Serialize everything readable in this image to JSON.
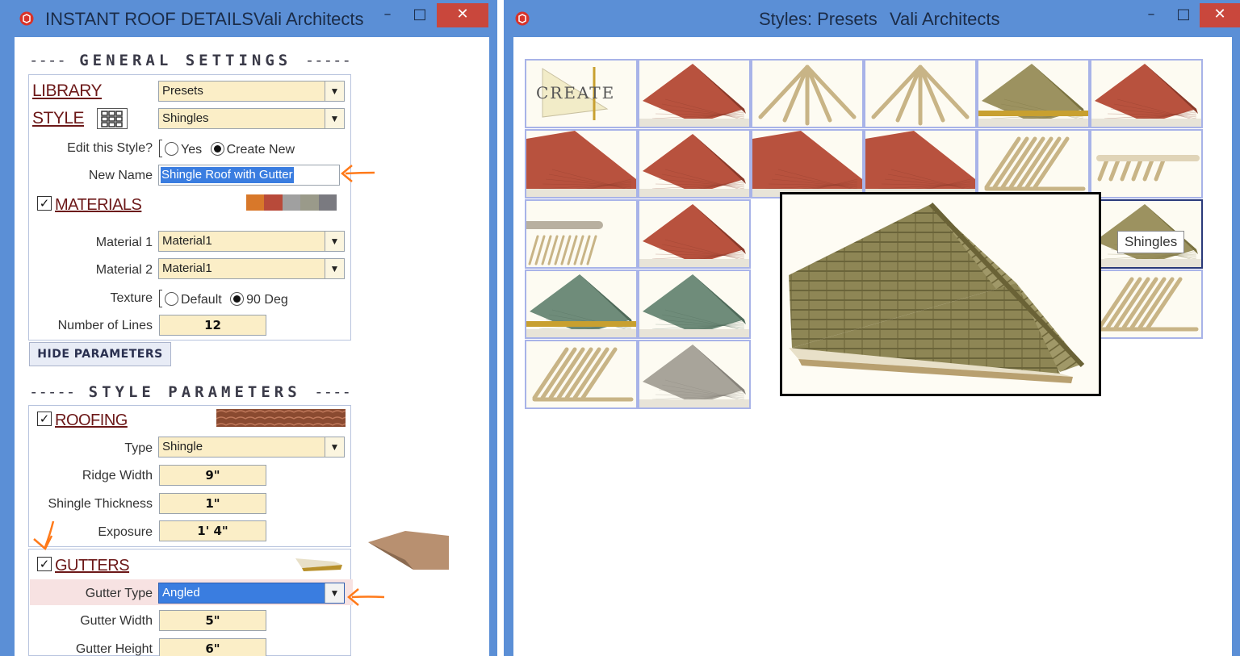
{
  "left_window": {
    "title": "INSTANT ROOF DETAILS",
    "subtitle": "Vali Architects",
    "min_label": "–",
    "max_label": "□",
    "close_label": "✕"
  },
  "right_window": {
    "title": "Styles: Presets",
    "subtitle": "Vali Architects",
    "min_label": "–",
    "max_label": "□",
    "close_label": "✕"
  },
  "general": {
    "heading_dash_left": "----",
    "heading": "GENERAL SETTINGS",
    "heading_dash_right": "-----",
    "library_label": "LIBRARY",
    "library_value": "Presets",
    "style_label": "STYLE",
    "style_value": "Shingles",
    "edit_style_label": "Edit this Style?",
    "edit_yes": "Yes",
    "edit_create_new": "Create New",
    "new_name_label": "New Name",
    "new_name_value": "Shingle Roof with Gutter",
    "materials_label": "MATERIALS",
    "materials_checked": "✓",
    "material1_label": "Material 1",
    "material1_value": "Material1",
    "material2_label": "Material 2",
    "material2_value": "Material1",
    "texture_label": "Texture",
    "texture_default": "Default",
    "texture_90": "90 Deg",
    "lines_label": "Number of Lines",
    "lines_value": "12",
    "hide_button": "HIDE PARAMETERS",
    "swatch_colors": [
      "#d8782a",
      "#b84a3a",
      "#a0a0a0",
      "#9a9a8a",
      "#7a7a80"
    ]
  },
  "style_params": {
    "heading_dash_left": "-----",
    "heading": "STYLE PARAMETERS",
    "heading_dash_right": "----",
    "roofing_label": "ROOFING",
    "roofing_checked": "✓",
    "type_label": "Type",
    "type_value": "Shingle",
    "ridge_label": "Ridge Width",
    "ridge_value": "9\"",
    "thickness_label": "Shingle Thickness",
    "thickness_value": "1\"",
    "exposure_label": "Exposure",
    "exposure_value": "1' 4\"",
    "gutters_label": "GUTTERS",
    "gutters_checked": "✓",
    "gutter_type_label": "Gutter Type",
    "gutter_type_value": "Angled",
    "gutter_width_label": "Gutter Width",
    "gutter_width_value": "5\"",
    "gutter_height_label": "Gutter Height",
    "gutter_height_value": "6\""
  },
  "gallery": {
    "create_tile_label": "CREATE",
    "tooltip": "Shingles",
    "tile_types": [
      [
        "create",
        "red-hip",
        "rafters",
        "rafters",
        "shingle-edge",
        "red-hip"
      ],
      [
        "red-tile",
        "red-hip",
        "red-tile",
        "red-tile",
        "trusses",
        "rafter-end"
      ],
      [
        "rafter-detail",
        "red-hip",
        "",
        "",
        "",
        "shingle-hip"
      ],
      [
        "green-edge",
        "green-hip",
        "",
        "",
        "",
        "trusses"
      ],
      [
        "trusses",
        "grey-hip",
        "",
        "",
        "",
        ""
      ]
    ]
  },
  "colors": {
    "titlebar": "#5b8fd6",
    "accent_label": "#6c1818",
    "field_bg": "#fbeec7",
    "selection": "#3a7de0",
    "arrow": "#ff7a1a"
  }
}
